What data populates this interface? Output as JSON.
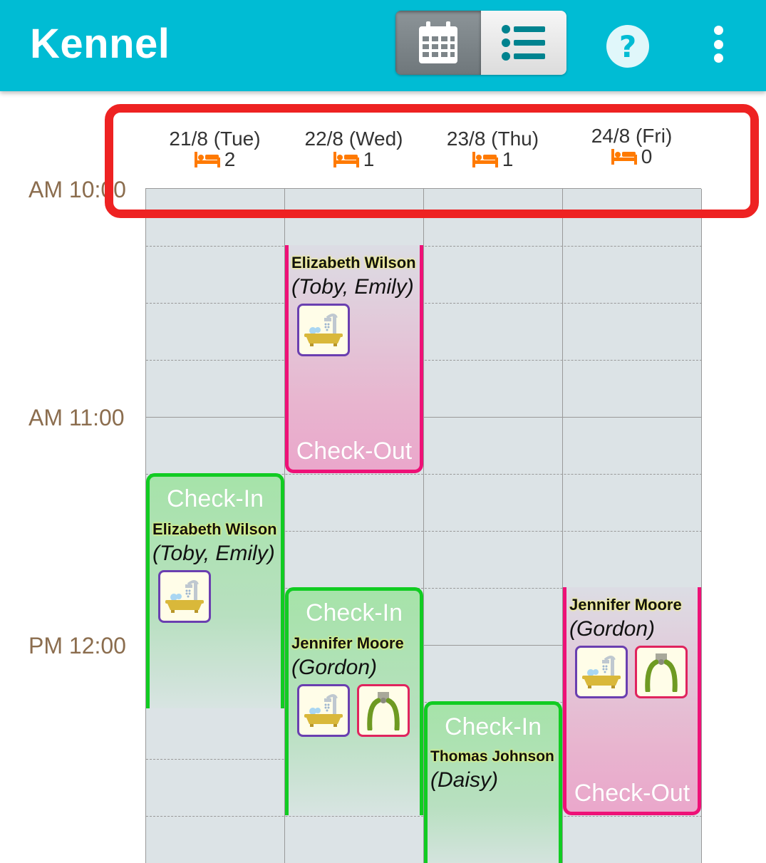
{
  "app": {
    "title": "Kennel"
  },
  "toolbar": {
    "calendar_icon": "calendar-icon",
    "list_icon": "list-icon",
    "help_icon": "help-icon",
    "more_icon": "more-vert-icon"
  },
  "days": [
    {
      "label": "21/8 (Tue)",
      "count": "2"
    },
    {
      "label": "22/8 (Wed)",
      "count": "1"
    },
    {
      "label": "23/8 (Thu)",
      "count": "1"
    },
    {
      "label": "24/8 (Fri)",
      "count": "0"
    }
  ],
  "times": {
    "t1000": "AM 10:00",
    "t1100": "AM 11:00",
    "t1200": "PM 12:00"
  },
  "events": {
    "e1": {
      "title": "Check-In",
      "owner": "Elizabeth Wilson",
      "pets": "(Toby, Emily)"
    },
    "e2": {
      "title": "Check-Out",
      "owner": "Elizabeth Wilson",
      "pets": "(Toby, Emily)"
    },
    "e3": {
      "title": "Check-In",
      "owner": "Jennifer Moore",
      "pets": "(Gordon)"
    },
    "e4": {
      "title": "Check-In",
      "owner": "Thomas Johnson",
      "pets": "(Daisy)"
    },
    "e5": {
      "title": "Check-Out",
      "owner": "Jennifer Moore",
      "pets": "(Gordon)"
    }
  },
  "colors": {
    "appbar": "#00BCD4",
    "checkin_border": "#11CC22",
    "checkout_border": "#EE1177",
    "highlight": "#EE2222",
    "bed_icon": "#FF7A00"
  }
}
